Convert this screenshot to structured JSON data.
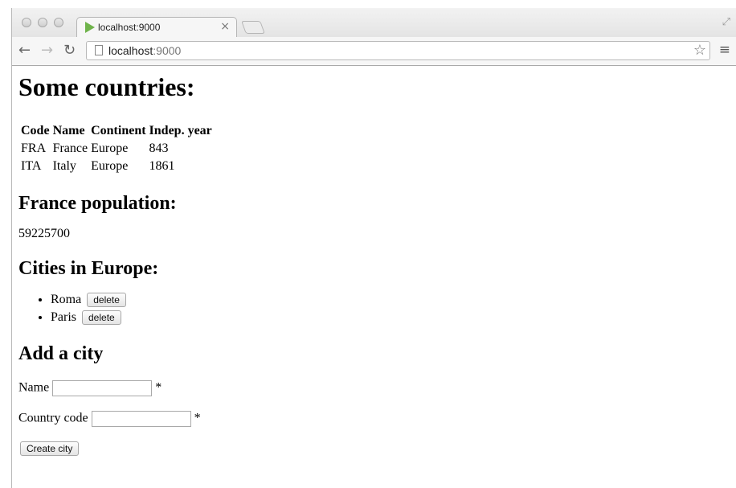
{
  "browser": {
    "tab_title": "localhost:9000",
    "tab_close": "×",
    "url_host": "localhost",
    "url_port": ":9000",
    "icons": {
      "back": "back-arrow-icon",
      "forward": "forward-arrow-icon",
      "reload": "reload-icon",
      "star": "star-icon",
      "menu": "menu-icon",
      "fullscreen": "fullscreen-icon"
    }
  },
  "page": {
    "title": "Some countries:",
    "countries_table": {
      "headers": [
        "Code",
        "Name",
        "Continent",
        "Indep. year"
      ],
      "rows": [
        [
          "FRA",
          "France",
          "Europe",
          "843"
        ],
        [
          "ITA",
          "Italy",
          "Europe",
          "1861"
        ]
      ]
    },
    "population_heading": "France population:",
    "population_value": "59225700",
    "cities_heading": "Cities in Europe:",
    "cities": [
      {
        "name": "Roma",
        "delete_label": "delete"
      },
      {
        "name": "Paris",
        "delete_label": "delete"
      }
    ],
    "add_city": {
      "heading": "Add a city",
      "name_label": "Name",
      "name_required": "*",
      "country_label": "Country code",
      "country_required": "*",
      "submit_label": "Create city"
    }
  }
}
